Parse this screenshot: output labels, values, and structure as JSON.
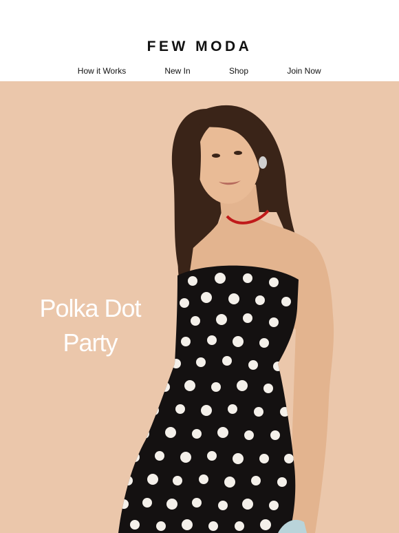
{
  "brand": {
    "name": "FEW MODA"
  },
  "nav": {
    "items": [
      {
        "label": "How it Works"
      },
      {
        "label": "New In"
      },
      {
        "label": "Shop"
      },
      {
        "label": "Join Now"
      }
    ]
  },
  "hero": {
    "headline_line1": "Polka Dot",
    "headline_line2": "Party",
    "background_color": "#ebc7ab"
  }
}
